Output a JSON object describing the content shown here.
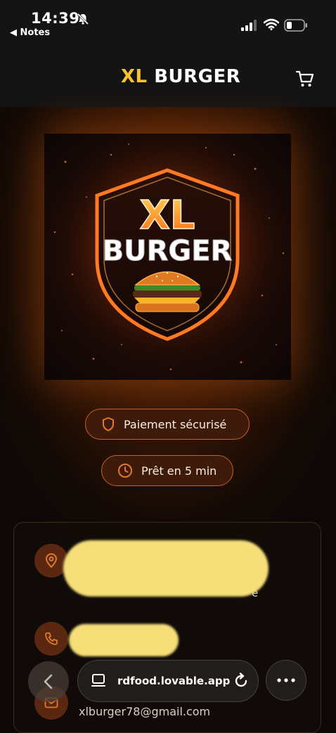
{
  "status_bar": {
    "time": "14:39",
    "back_app": "◀ Notes"
  },
  "header": {
    "brand_xl": "XL",
    "brand_burger": "BURGER",
    "cart_icon": "cart-icon"
  },
  "logo": {
    "line1": "XL",
    "line2": "BURGER"
  },
  "badges": {
    "secure_label": "Paiement sécurisé",
    "ready_label": "Prêt en 5 min"
  },
  "contact": {
    "address_tail": "e",
    "email": "xlburger78@gmail.com"
  },
  "browser": {
    "url": "rdfood.lovable.app"
  },
  "colors": {
    "accent_yellow": "#f7c431",
    "accent_orange": "#e07a2a",
    "background": "#0c0806"
  }
}
